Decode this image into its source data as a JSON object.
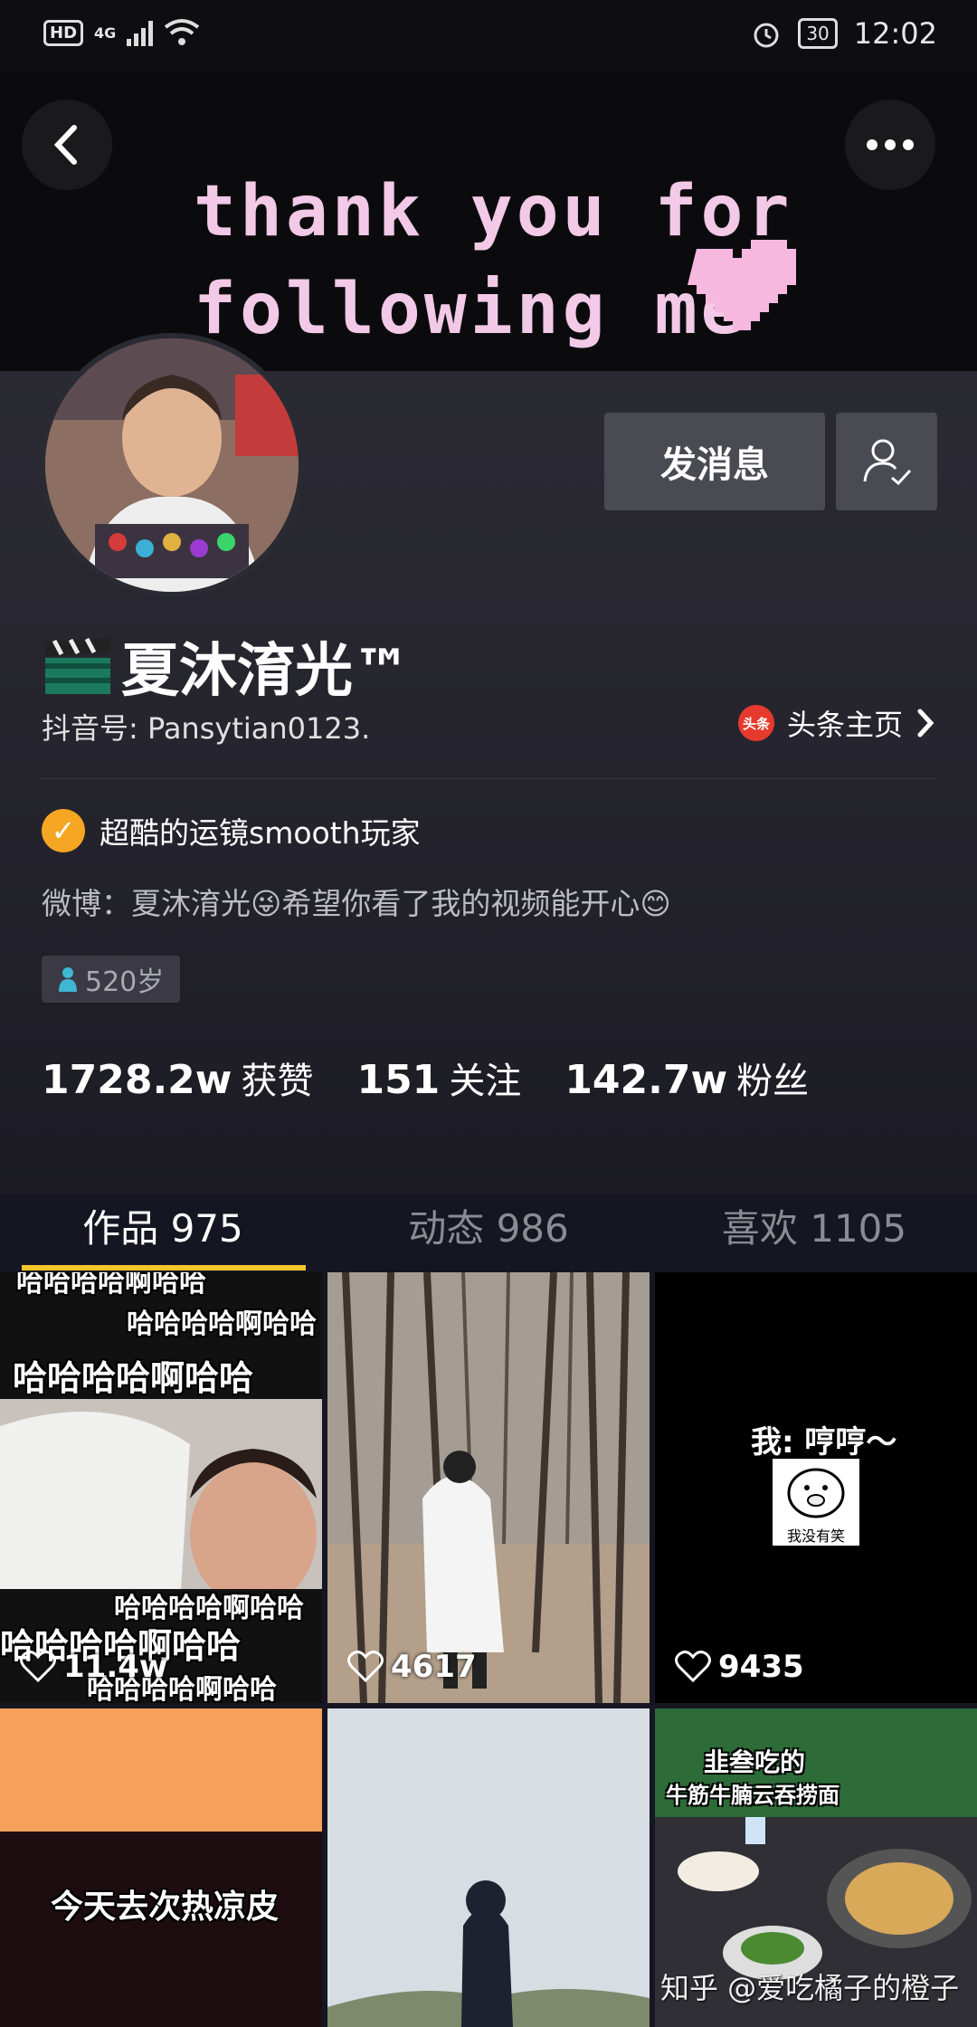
{
  "status_bar": {
    "hd": "HD",
    "network": "4G",
    "battery": "30",
    "time": "12:02"
  },
  "banner": {
    "line1": "thank you for",
    "line2": "following me"
  },
  "profile": {
    "message_button": "发消息",
    "name": "夏沐淯光™",
    "douyin_id": "抖音号: Pansytian0123.",
    "toutiao_logo": "头条",
    "toutiao_link": "头条主页",
    "verify_text": "超酷的运镜smooth玩家",
    "bio": "微博：夏沐淯光😜希望你看了我的视频能开心😊",
    "age": "520岁"
  },
  "stats": [
    {
      "num": "1728.2w",
      "label": "获赞"
    },
    {
      "num": "151",
      "label": "关注"
    },
    {
      "num": "142.7w",
      "label": "粉丝"
    }
  ],
  "tabs": [
    {
      "label": "作品 975"
    },
    {
      "label": "动态 986"
    },
    {
      "label": "喜欢 1105"
    }
  ],
  "videos": [
    {
      "likes": "11.4w",
      "caption_top1": "哈哈哈哈啊哈哈",
      "caption_top2": "哈哈哈哈啊哈哈",
      "caption_top3": "哈哈哈哈啊哈哈",
      "caption_b1": "哈哈哈哈啊哈哈",
      "caption_b2": "哈哈哈哈啊哈哈",
      "caption_b3": "哈哈哈哈啊哈哈"
    },
    {
      "likes": "4617"
    },
    {
      "likes": "9435",
      "caption": "我: 哼哼～",
      "sticker": "我没有笑"
    },
    {
      "caption": "今天去次热凉皮"
    },
    {},
    {
      "caption1": "韭叁吃的",
      "caption2": "牛筋牛腩云吞捞面"
    }
  ],
  "watermark": "知乎 @爱吃橘子的橙子",
  "colors": {
    "accent": "#f8c62a",
    "verify": "#f5a623",
    "toutiao": "#e63a2e"
  }
}
